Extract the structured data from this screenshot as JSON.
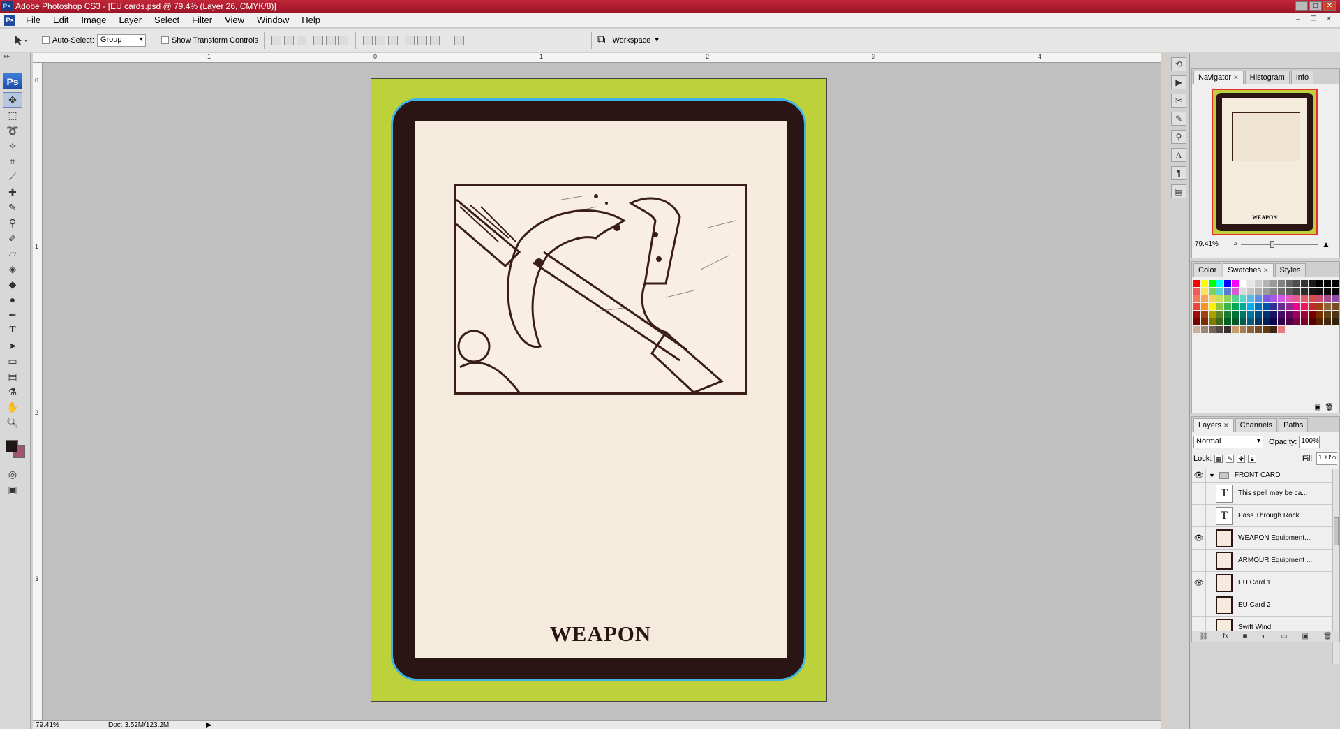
{
  "window": {
    "title": "Adobe Photoshop CS3 - [EU cards.psd @ 79.4% (Layer 26, CMYK/8)]",
    "app_icon": "Ps"
  },
  "menu": [
    "File",
    "Edit",
    "Image",
    "Layer",
    "Select",
    "Filter",
    "View",
    "Window",
    "Help"
  ],
  "options": {
    "auto_select_label": "Auto-Select:",
    "auto_select_value": "Group",
    "show_transform_label": "Show Transform Controls",
    "workspace_label": "Workspace"
  },
  "toolbox": {
    "logo": "Ps",
    "tools": [
      "move-icon",
      "marquee-icon",
      "lasso-icon",
      "magic-wand-icon",
      "crop-icon",
      "slice-icon",
      "healing-icon",
      "brush-icon",
      "clone-stamp-icon",
      "history-brush-icon",
      "eraser-icon",
      "paint-bucket-icon",
      "blur-icon",
      "dodge-icon",
      "pen-icon",
      "type-icon",
      "path-select-icon",
      "shape-icon",
      "notes-icon",
      "eyedropper-icon",
      "hand-icon",
      "zoom-icon"
    ],
    "fg_color": "#1f1616",
    "bg_color": "#a25572"
  },
  "rulers": {
    "top": [
      "1",
      "0",
      "1",
      "2",
      "3",
      "4"
    ],
    "left": [
      "0",
      "1",
      "2",
      "3"
    ]
  },
  "card": {
    "title": "WEAPON",
    "background_color": "#bdd13b",
    "frame_color": "#2b1414",
    "border_color": "#3fb3e8",
    "paper_color": "#f5ebdd"
  },
  "status": {
    "zoom": "79.41%",
    "doc": "Doc: 3.52M/123.2M"
  },
  "navigator": {
    "tabs": [
      "Navigator",
      "Histogram",
      "Info"
    ],
    "zoom": "79.41%",
    "mini_title": "WEAPON",
    "zoom_slider_position": 0.4
  },
  "swatches_panel": {
    "tabs": [
      "Color",
      "Swatches",
      "Styles"
    ],
    "colors": [
      "#ff0000",
      "#ffff00",
      "#00ff00",
      "#00ffff",
      "#0000ff",
      "#ff00ff",
      "#ffffff",
      "#e6e6e6",
      "#cccccc",
      "#b3b3b3",
      "#999999",
      "#808080",
      "#666666",
      "#4d4d4d",
      "#333333",
      "#1a1a1a",
      "#000000",
      "#000000",
      "#000000",
      "#f05a5a",
      "#fbe25a",
      "#7ad35a",
      "#5ad3d3",
      "#5a7ad3",
      "#d35ad3",
      "#d9d9d9",
      "#c6c6c6",
      "#b0b0b0",
      "#9a9a9a",
      "#848484",
      "#6e6e6e",
      "#585858",
      "#424242",
      "#2c2c2c",
      "#161616",
      "#111111",
      "#0a0a0a",
      "#050505",
      "#f27a5a",
      "#f5a55a",
      "#f5d05a",
      "#c9e15a",
      "#8fd35a",
      "#5ad38f",
      "#5ad3c9",
      "#5ab8e6",
      "#5a8fe6",
      "#7a5ae6",
      "#a55ae6",
      "#d35ae6",
      "#e65ab8",
      "#e65a8f",
      "#e65a6e",
      "#d94c4c",
      "#c94c6e",
      "#a54c8f",
      "#8f4ca5",
      "#ef4536",
      "#f7941d",
      "#fff200",
      "#8dc63f",
      "#39b54a",
      "#00a651",
      "#00a99d",
      "#00aeef",
      "#0072bc",
      "#0054a6",
      "#2e3192",
      "#662d91",
      "#92278f",
      "#ec008c",
      "#ed145b",
      "#c1272d",
      "#a0410d",
      "#8c6239",
      "#754c24",
      "#9e0b0f",
      "#a0410d",
      "#aba000",
      "#598527",
      "#197b30",
      "#007236",
      "#00746b",
      "#0076a3",
      "#004a80",
      "#003471",
      "#1b1464",
      "#440e62",
      "#630460",
      "#9e005d",
      "#9e0039",
      "#790000",
      "#7b2e00",
      "#5f4019",
      "#4d3313",
      "#790000",
      "#7b2e00",
      "#827b00",
      "#406618",
      "#005e20",
      "#005826",
      "#005952",
      "#005b7f",
      "#003663",
      "#002157",
      "#0d004c",
      "#32004b",
      "#4b0049",
      "#7b0046",
      "#7a0026",
      "#580000",
      "#5a2100",
      "#41280f",
      "#33200a",
      "#c7b299",
      "#998675",
      "#736357",
      "#534741",
      "#37302d",
      "#c69c6d",
      "#a67c52",
      "#8c6239",
      "#754c24",
      "#603913",
      "#3c2415",
      "#e87c7c"
    ]
  },
  "layers_panel": {
    "tabs": [
      "Layers",
      "Channels",
      "Paths"
    ],
    "blend_mode": "Normal",
    "opacity_label": "Opacity:",
    "opacity": "100%",
    "lock_label": "Lock:",
    "fill_label": "Fill:",
    "fill": "100%",
    "group_name": "FRONT CARD",
    "layers": [
      {
        "name": "This spell may be ca...",
        "type": "text",
        "visible": false
      },
      {
        "name": "Pass Through Rock",
        "type": "text",
        "visible": false
      },
      {
        "name": "WEAPON Equipment...",
        "type": "image",
        "visible": true
      },
      {
        "name": "ARMOUR Equipment ...",
        "type": "image",
        "visible": false
      },
      {
        "name": "EU Card 1",
        "type": "image",
        "visible": true
      },
      {
        "name": "EU Card 2",
        "type": "image",
        "visible": false
      },
      {
        "name": "Swift Wind",
        "type": "image",
        "visible": false
      }
    ]
  }
}
